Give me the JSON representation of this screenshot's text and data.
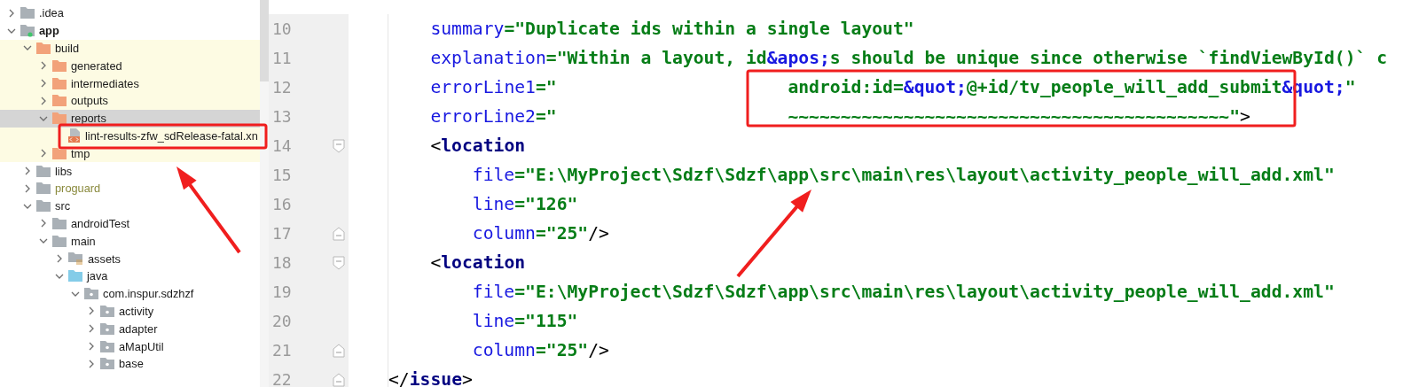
{
  "project_tree": {
    "items": [
      {
        "label": ".idea",
        "kind": "folder",
        "expanded": false,
        "selected": false
      },
      {
        "label": "app",
        "kind": "module",
        "expanded": true,
        "selected": false,
        "bold": true,
        "children": [
          {
            "label": "build",
            "kind": "build-folder",
            "expanded": true,
            "selected": false,
            "excluded": true,
            "children": [
              {
                "label": "generated",
                "kind": "build-folder",
                "expanded": false,
                "selected": false
              },
              {
                "label": "intermediates",
                "kind": "build-folder",
                "expanded": false,
                "selected": false
              },
              {
                "label": "outputs",
                "kind": "build-folder",
                "expanded": false,
                "selected": false
              },
              {
                "label": "reports",
                "kind": "build-folder",
                "expanded": true,
                "selected": true,
                "children": [
                  {
                    "label": "lint-results-zfw_sdRelease-fatal.xn",
                    "kind": "xml-file",
                    "selected": false
                  }
                ]
              },
              {
                "label": "tmp",
                "kind": "build-folder",
                "expanded": false,
                "selected": false
              }
            ]
          },
          {
            "label": "libs",
            "kind": "folder",
            "expanded": false,
            "selected": false
          },
          {
            "label": "proguard",
            "kind": "folder",
            "expanded": false,
            "selected": false,
            "ignored": true
          },
          {
            "label": "src",
            "kind": "folder",
            "expanded": true,
            "selected": false,
            "children": [
              {
                "label": "androidTest",
                "kind": "folder",
                "expanded": false,
                "selected": false
              },
              {
                "label": "main",
                "kind": "folder",
                "expanded": true,
                "selected": false,
                "children": [
                  {
                    "label": "assets",
                    "kind": "resources",
                    "expanded": false,
                    "selected": false
                  },
                  {
                    "label": "java",
                    "kind": "source-root",
                    "expanded": true,
                    "selected": false,
                    "children": [
                      {
                        "label": "com.inspur.sdzhzf",
                        "kind": "package",
                        "expanded": true,
                        "selected": false,
                        "children": [
                          {
                            "label": "activity",
                            "kind": "package",
                            "expanded": false,
                            "selected": false
                          },
                          {
                            "label": "adapter",
                            "kind": "package",
                            "expanded": false,
                            "selected": false
                          },
                          {
                            "label": "aMapUtil",
                            "kind": "package",
                            "expanded": false,
                            "selected": false
                          },
                          {
                            "label": "base",
                            "kind": "package",
                            "expanded": false,
                            "selected": false
                          }
                        ]
                      }
                    ]
                  }
                ]
              }
            ]
          }
        ]
      }
    ]
  },
  "editor": {
    "lines": [
      {
        "number": "10",
        "kind": "attribute",
        "fold_start": false,
        "fold_end": false,
        "tokens": [
          {
            "kind": "attr",
            "text": "summary"
          },
          {
            "kind": "string",
            "text": "=\"Duplicate ids within a single layout\""
          }
        ]
      },
      {
        "number": "11",
        "kind": "attribute",
        "fold_start": false,
        "fold_end": false,
        "tokens": [
          {
            "kind": "attr",
            "text": "explanation"
          },
          {
            "kind": "string",
            "text": "=\"Within a layout, id"
          },
          {
            "kind": "entity",
            "text": "&apos;"
          },
          {
            "kind": "string",
            "text": "s should be unique since otherwise `findViewById()` c"
          }
        ]
      },
      {
        "number": "12",
        "kind": "attribute",
        "fold_start": false,
        "fold_end": false,
        "tokens": [
          {
            "kind": "attr",
            "text": "errorLine1"
          },
          {
            "kind": "string",
            "text": "=\"                      android:id="
          },
          {
            "kind": "entity",
            "text": "&quot;"
          },
          {
            "kind": "string",
            "text": "@+id/tv_people_will_add_submit"
          },
          {
            "kind": "entity",
            "text": "&quot;"
          },
          {
            "kind": "string",
            "text": "\""
          }
        ]
      },
      {
        "number": "13",
        "kind": "attribute",
        "fold_start": false,
        "fold_end": false,
        "tokens": [
          {
            "kind": "attr",
            "text": "errorLine2"
          },
          {
            "kind": "string",
            "text": "=\"                      ~~~~~~~~~~~~~~~~~~~~~~~~~~~~~~~~~~~~~~~~~~\""
          },
          {
            "kind": "punct",
            "text": ">"
          }
        ]
      },
      {
        "number": "14",
        "kind": "child-tag",
        "fold_start": true,
        "fold_end": false,
        "tokens": [
          {
            "kind": "punct",
            "text": "<"
          },
          {
            "kind": "tag",
            "text": "location"
          }
        ]
      },
      {
        "number": "15",
        "kind": "child-attribute",
        "fold_start": false,
        "fold_end": false,
        "tokens": [
          {
            "kind": "attr",
            "text": "file"
          },
          {
            "kind": "string",
            "text": "=\"E:\\MyProject\\Sdzf\\Sdzf\\app\\src\\main\\res\\layout\\activity_people_will_add.xml\""
          }
        ]
      },
      {
        "number": "16",
        "kind": "child-attribute",
        "fold_start": false,
        "fold_end": false,
        "tokens": [
          {
            "kind": "attr",
            "text": "line"
          },
          {
            "kind": "string",
            "text": "=\"126\""
          }
        ]
      },
      {
        "number": "17",
        "kind": "child-attribute",
        "fold_start": false,
        "fold_end": true,
        "tokens": [
          {
            "kind": "attr",
            "text": "column"
          },
          {
            "kind": "string",
            "text": "=\"25\""
          },
          {
            "kind": "punct",
            "text": "/>"
          }
        ]
      },
      {
        "number": "18",
        "kind": "child-tag",
        "fold_start": true,
        "fold_end": false,
        "tokens": [
          {
            "kind": "punct",
            "text": "<"
          },
          {
            "kind": "tag",
            "text": "location"
          }
        ]
      },
      {
        "number": "19",
        "kind": "child-attribute",
        "fold_start": false,
        "fold_end": false,
        "tokens": [
          {
            "kind": "attr",
            "text": "file"
          },
          {
            "kind": "string",
            "text": "=\"E:\\MyProject\\Sdzf\\Sdzf\\app\\src\\main\\res\\layout\\activity_people_will_add.xml\""
          }
        ]
      },
      {
        "number": "20",
        "kind": "child-attribute",
        "fold_start": false,
        "fold_end": false,
        "tokens": [
          {
            "kind": "attr",
            "text": "line"
          },
          {
            "kind": "string",
            "text": "=\"115\""
          }
        ]
      },
      {
        "number": "21",
        "kind": "child-attribute",
        "fold_start": false,
        "fold_end": true,
        "tokens": [
          {
            "kind": "attr",
            "text": "column"
          },
          {
            "kind": "string",
            "text": "=\"25\""
          },
          {
            "kind": "punct",
            "text": "/>"
          }
        ]
      },
      {
        "number": "22",
        "kind": "closing-tag",
        "fold_start": false,
        "fold_end": true,
        "tokens": [
          {
            "kind": "punct",
            "text": "</"
          },
          {
            "kind": "tag",
            "text": "issue"
          },
          {
            "kind": "punct",
            "text": ">"
          }
        ]
      }
    ]
  },
  "annotations": [
    {
      "kind": "box"
    },
    {
      "kind": "box"
    },
    {
      "kind": "arrow"
    },
    {
      "kind": "arrow"
    }
  ]
}
